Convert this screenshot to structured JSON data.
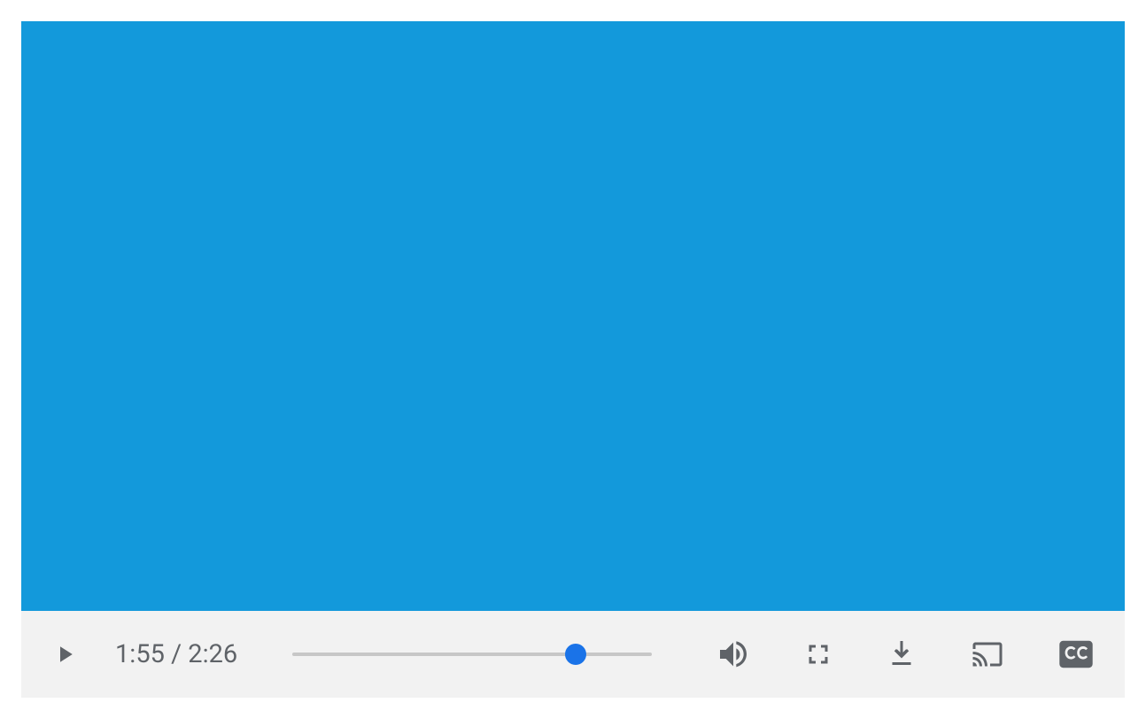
{
  "player": {
    "current_time": "1:55",
    "duration": "2:26",
    "time_separator": " / ",
    "progress_percent": 78.8,
    "colors": {
      "video_bg": "#1399db",
      "controls_bg": "#f2f2f2",
      "icon": "#5f6368",
      "text": "#5f6368",
      "progress_track": "#c7c7c7",
      "progress_thumb": "#1a73e8"
    },
    "icons": {
      "play": "play-icon",
      "volume": "volume-icon",
      "fullscreen": "fullscreen-icon",
      "download": "download-icon",
      "cast": "cast-icon",
      "captions": "captions-icon"
    }
  }
}
